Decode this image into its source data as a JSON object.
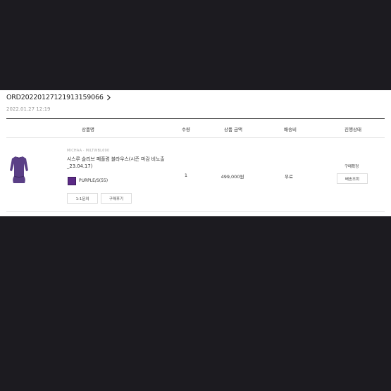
{
  "order": {
    "id": "ORD20220127121913159066",
    "date": "2022.01.27 12:19"
  },
  "table": {
    "headers": {
      "product": "상품명",
      "quantity": "수량",
      "price": "상품 금액",
      "shipping": "배송비",
      "status": "진행상태"
    }
  },
  "item": {
    "brand": "MICHAA · MILTWBL690",
    "name_line1": "시스루 슬리브 페플럼 블라우스(시즌 마감 비노출",
    "name_line2": "_23.04.17)",
    "option": "PURPLE/S(55)",
    "swatch_color": "#5b2a86",
    "quantity": "1",
    "price": "499,000원",
    "shipping": "무료",
    "status": "구매확정",
    "track_button": "배송조회",
    "inquiry_button": "1:1문의",
    "review_button": "구매후기"
  },
  "colors": {
    "backdrop": "#1c1b20",
    "panel": "#ffffff",
    "garment": "#5a3f86"
  },
  "icons": {
    "chevron": "chevron-right-icon"
  }
}
